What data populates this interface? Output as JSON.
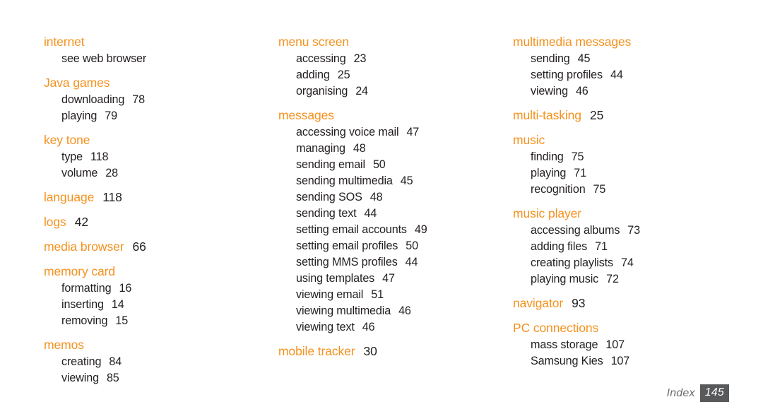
{
  "document": {
    "page_kind": "index",
    "background_color": "#ffffff",
    "heading_color": "#f5911e",
    "body_text_color": "#231f20",
    "footer_box_color": "#58595b"
  },
  "footer": {
    "label": "Index",
    "page_number": "145"
  },
  "columns": [
    {
      "id": "column-1",
      "groups": [
        {
          "heading": "internet",
          "heading_page": "",
          "entries": [
            {
              "label": "see web browser",
              "page": ""
            }
          ]
        },
        {
          "heading": "Java games",
          "heading_page": "",
          "entries": [
            {
              "label": "downloading",
              "page": "78"
            },
            {
              "label": "playing",
              "page": "79"
            }
          ]
        },
        {
          "heading": "key tone",
          "heading_page": "",
          "entries": [
            {
              "label": "type",
              "page": "118"
            },
            {
              "label": "volume",
              "page": "28"
            }
          ]
        },
        {
          "heading": "language",
          "heading_page": "118",
          "entries": []
        },
        {
          "heading": "logs",
          "heading_page": "42",
          "entries": []
        },
        {
          "heading": "media browser",
          "heading_page": "66",
          "entries": []
        },
        {
          "heading": "memory card",
          "heading_page": "",
          "entries": [
            {
              "label": "formatting",
              "page": "16"
            },
            {
              "label": "inserting",
              "page": "14"
            },
            {
              "label": "removing",
              "page": "15"
            }
          ]
        },
        {
          "heading": "memos",
          "heading_page": "",
          "entries": [
            {
              "label": "creating",
              "page": "84"
            },
            {
              "label": "viewing",
              "page": "85"
            }
          ]
        }
      ]
    },
    {
      "id": "column-2",
      "groups": [
        {
          "heading": "menu screen",
          "heading_page": "",
          "entries": [
            {
              "label": "accessing",
              "page": "23"
            },
            {
              "label": "adding",
              "page": "25"
            },
            {
              "label": "organising",
              "page": "24"
            }
          ]
        },
        {
          "heading": "messages",
          "heading_page": "",
          "entries": [
            {
              "label": "accessing voice mail",
              "page": "47"
            },
            {
              "label": "managing",
              "page": "48"
            },
            {
              "label": "sending email",
              "page": "50"
            },
            {
              "label": "sending multimedia",
              "page": "45"
            },
            {
              "label": "sending SOS",
              "page": "48"
            },
            {
              "label": "sending text",
              "page": "44"
            },
            {
              "label": "setting email accounts",
              "page": "49"
            },
            {
              "label": "setting email profiles",
              "page": "50"
            },
            {
              "label": "setting MMS profiles",
              "page": "44"
            },
            {
              "label": "using templates",
              "page": "47"
            },
            {
              "label": "viewing email",
              "page": "51"
            },
            {
              "label": "viewing multimedia",
              "page": "46"
            },
            {
              "label": "viewing text",
              "page": "46"
            }
          ]
        },
        {
          "heading": "mobile tracker",
          "heading_page": "30",
          "entries": []
        }
      ]
    },
    {
      "id": "column-3",
      "groups": [
        {
          "heading": "multimedia messages",
          "heading_page": "",
          "entries": [
            {
              "label": "sending",
              "page": "45"
            },
            {
              "label": "setting profiles",
              "page": "44"
            },
            {
              "label": "viewing",
              "page": "46"
            }
          ]
        },
        {
          "heading": "multi-tasking",
          "heading_page": "25",
          "entries": []
        },
        {
          "heading": "music",
          "heading_page": "",
          "entries": [
            {
              "label": "finding",
              "page": "75"
            },
            {
              "label": "playing",
              "page": "71"
            },
            {
              "label": "recognition",
              "page": "75"
            }
          ]
        },
        {
          "heading": "music player",
          "heading_page": "",
          "entries": [
            {
              "label": "accessing albums",
              "page": "73"
            },
            {
              "label": "adding files",
              "page": "71"
            },
            {
              "label": "creating playlists",
              "page": "74"
            },
            {
              "label": "playing music",
              "page": "72"
            }
          ]
        },
        {
          "heading": "navigator",
          "heading_page": "93",
          "entries": []
        },
        {
          "heading": "PC connections",
          "heading_page": "",
          "entries": [
            {
              "label": "mass storage",
              "page": "107"
            },
            {
              "label": "Samsung Kies",
              "page": "107"
            }
          ]
        }
      ]
    }
  ]
}
